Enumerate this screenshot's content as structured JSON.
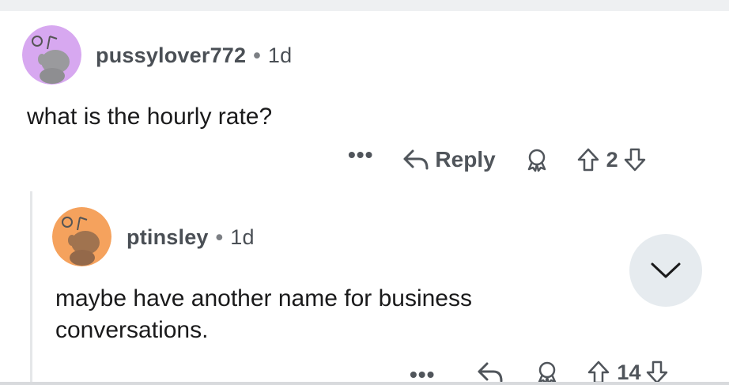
{
  "comment": {
    "username": "pussylover772",
    "separator": "•",
    "age": "1d",
    "text": "what is the hourly rate?",
    "avatar_color": "#d7a8f0",
    "actions": {
      "more_label": "•••",
      "reply_label": "Reply",
      "vote_count": "2"
    }
  },
  "reply": {
    "username": "ptinsley",
    "separator": "•",
    "age": "1d",
    "text_line1": "maybe have another name for business",
    "text_line2": "conversations.",
    "avatar_color": "#f5a25d",
    "actions": {
      "more_label": "•••",
      "vote_count": "14"
    }
  },
  "icons": {
    "reply": "reply-arrow-icon",
    "award": "award-icon",
    "upvote": "upvote-arrow-icon",
    "downvote": "downvote-arrow-icon",
    "collapse": "chevron-down-icon"
  },
  "colors": {
    "text": "#1a1a1b",
    "meta": "#4a4f55",
    "action": "#50555b",
    "collapse_bg": "#e6ebef"
  }
}
